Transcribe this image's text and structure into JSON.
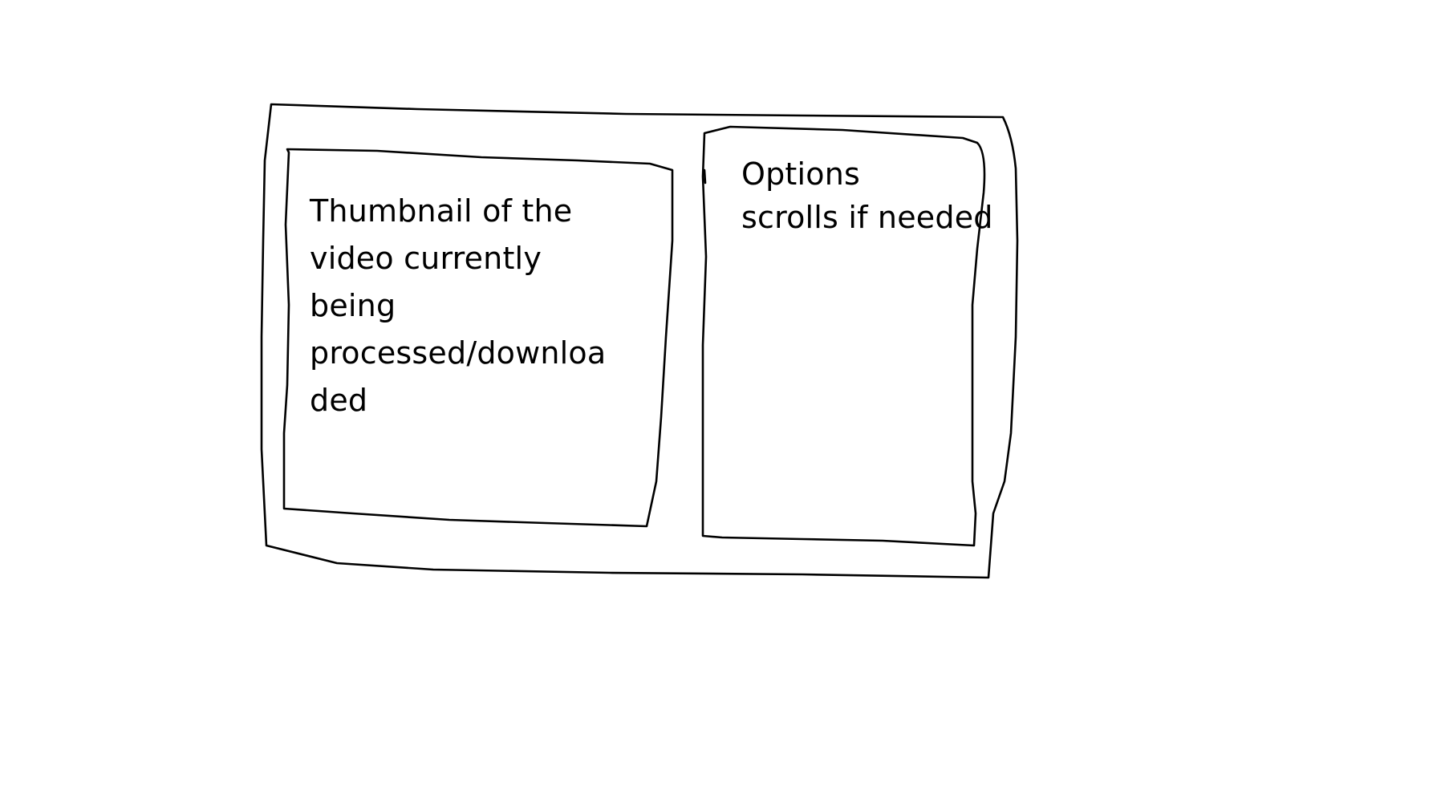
{
  "window": {
    "name": "outer-window-frame"
  },
  "thumbnail_panel": {
    "lines": [
      "Thumbnail of the",
      "video currently",
      "being",
      "processed/downloa",
      "ded"
    ]
  },
  "options_panel": {
    "lines": [
      "Options",
      "scrolls if needed"
    ]
  },
  "colors": {
    "ink": "#000000",
    "paper": "#ffffff"
  }
}
